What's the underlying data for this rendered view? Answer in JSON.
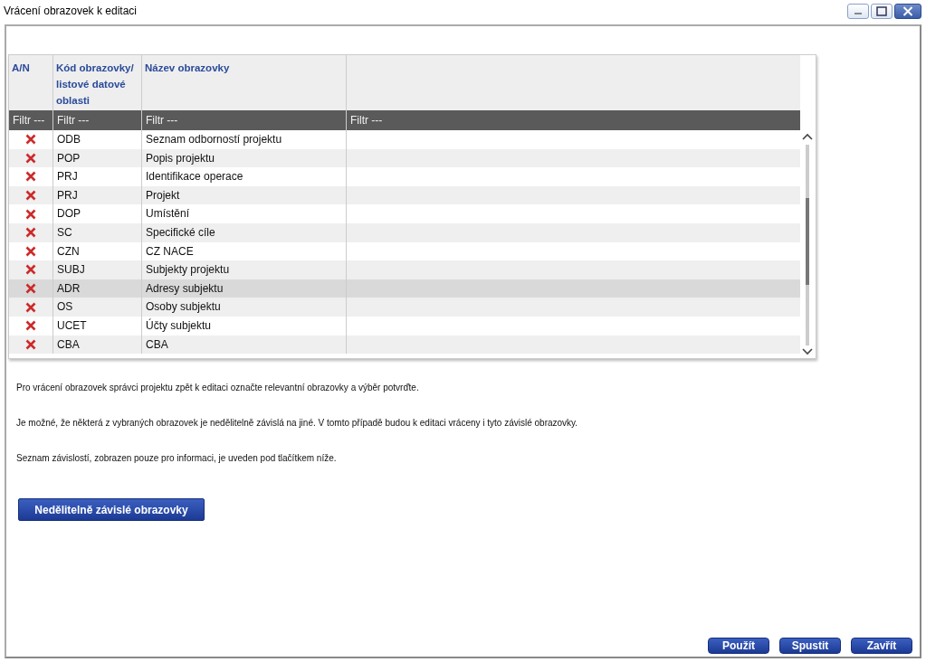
{
  "window": {
    "title": "Vrácení obrazovek k editaci"
  },
  "table": {
    "columns": [
      "A/N",
      "Kód obrazovky/ listové datové oblasti",
      "Název obrazovky"
    ],
    "filters": [
      {
        "placeholder": "Filtr ---"
      },
      {
        "placeholder": "Filtr ---"
      },
      {
        "placeholder": "Filtr ---"
      },
      {
        "placeholder": "Filtr ---"
      }
    ],
    "rows": [
      {
        "code": "ODB",
        "name": "Seznam odborností projektu",
        "selected": false
      },
      {
        "code": "POP",
        "name": "Popis projektu",
        "selected": false
      },
      {
        "code": "PRJ",
        "name": "Identifikace operace",
        "selected": false
      },
      {
        "code": "PRJ",
        "name": "Projekt",
        "selected": false
      },
      {
        "code": "DOP",
        "name": "Umístění",
        "selected": false
      },
      {
        "code": "SC",
        "name": "Specifické cíle",
        "selected": false
      },
      {
        "code": "CZN",
        "name": "CZ NACE",
        "selected": false
      },
      {
        "code": "SUBJ",
        "name": "Subjekty projektu",
        "selected": false
      },
      {
        "code": "ADR",
        "name": "Adresy subjektu",
        "selected": true
      },
      {
        "code": "OS",
        "name": "Osoby subjektu",
        "selected": false
      },
      {
        "code": "UCET",
        "name": "Účty subjektu",
        "selected": false
      },
      {
        "code": "CBA",
        "name": "CBA",
        "selected": false
      }
    ]
  },
  "paragraphs": [
    "Pro vrácení obrazovek správci projektu zpět k editaci označte relevantní obrazovky a výběr potvrďte.",
    "Je možné, že některá z vybraných obrazovek je nedělitelně závislá na jiné. V tomto případě budou k editaci vráceny i tyto závislé obrazovky.",
    "Seznam závislostí, zobrazen pouze pro informaci, je uveden pod tlačítkem níže."
  ],
  "dependent_button": "Nedělitelně závislé obrazovky",
  "footer_buttons": [
    "Použít",
    "Spustit",
    "Zavřít"
  ]
}
